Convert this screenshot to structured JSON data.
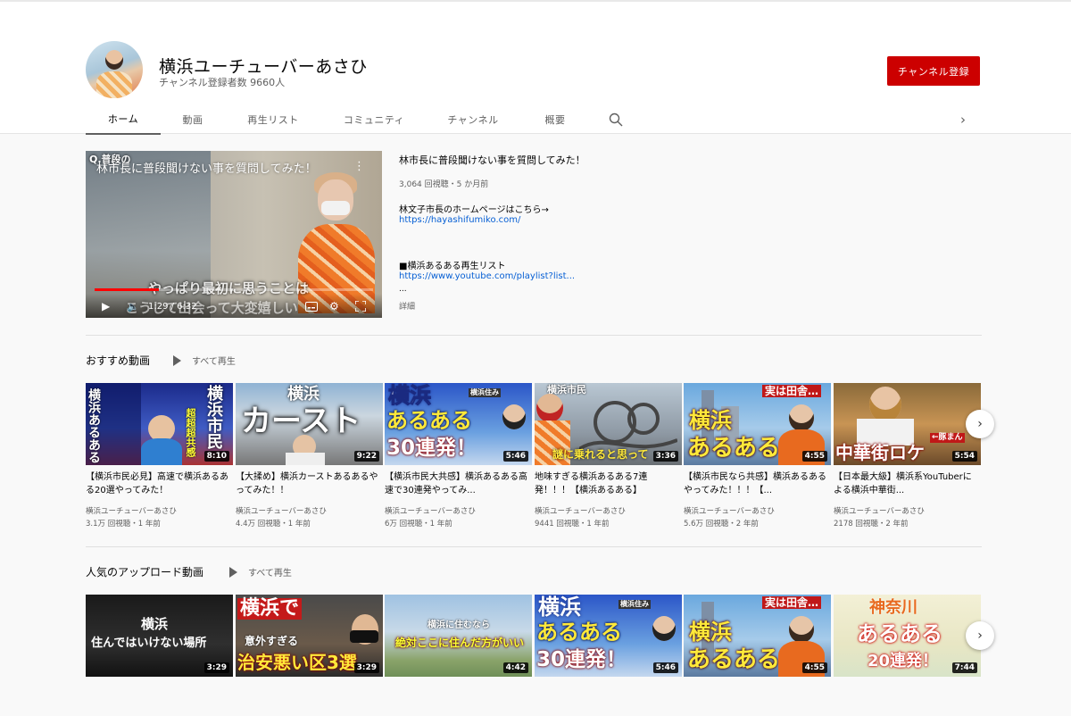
{
  "channel": {
    "name": "横浜ユーチューバーあさひ",
    "subscribers": "チャンネル登録者数 9660人",
    "subscribe_label": "チャンネル登録"
  },
  "tabs": [
    "ホーム",
    "動画",
    "再生リスト",
    "コミュニティ",
    "チャンネル",
    "概要"
  ],
  "featured": {
    "overlay_title": "林市長に普段聞けない事を質問してみた！",
    "overlay_question": "Q.普段の",
    "caption_line1": "やっぱり最初に思うことは",
    "caption_line2": "こうして出会って大変嬉しい",
    "time": "1:29 / 6:32",
    "progress": 0.23,
    "title": "林市長に普段聞けない事を質問してみた！",
    "meta": "3,064 回視聴・5 か月前",
    "desc1": "林文子市長のホームページはこちら→",
    "link1": "https://hayashifumiko.com/",
    "desc2": "■横浜あるある再生リスト",
    "link2": "https://www.youtube.com/playlist?list...",
    "ellipsis": "...",
    "more": "詳細"
  },
  "shelf1": {
    "title": "おすすめ動画",
    "play_all": "すべて再生",
    "videos": [
      {
        "title": "【横浜市民必見】高速で横浜あるある20選やってみた！",
        "channel": "横浜ユーチューバーあさひ",
        "meta": "3.1万 回視聴・1 年前",
        "duration": "8:10",
        "thumb_text": "横浜市民",
        "thumb_text2": "横浜あるある",
        "thumb_sub": "超超超共感"
      },
      {
        "title": "【大揉め】横浜カーストあるあるやってみた！！",
        "channel": "横浜ユーチューバーあさひ",
        "meta": "4.4万 回視聴・1 年前",
        "duration": "9:22",
        "thumb_text": "横浜",
        "thumb_text2": "カースト"
      },
      {
        "title": "【横浜市民大共感】横浜あるある高速で30連発やってみ...",
        "channel": "横浜ユーチューバーあさひ",
        "meta": "6万 回視聴・1 年前",
        "duration": "5:46",
        "thumb_text": "横浜",
        "thumb_text2": "あるある",
        "thumb_sub": "30連発！",
        "thumb_tag": "横浜住み"
      },
      {
        "title": "地味すぎる横浜あるある7連発！！！【横浜あるある】",
        "channel": "横浜ユーチューバーあさひ",
        "meta": "9441 回視聴・1 年前",
        "duration": "3:36",
        "thumb_text": "横浜市民",
        "thumb_text2": "謎に乗れると思って"
      },
      {
        "title": "【横浜市民なら共感】横浜あるあるやってみた！！！【...",
        "channel": "横浜ユーチューバーあさひ",
        "meta": "5.6万 回視聴・2 年前",
        "duration": "4:55",
        "thumb_text": "実は田舎…",
        "thumb_text2": "横浜",
        "thumb_sub": "あるある"
      },
      {
        "title": "【日本最大級】横浜系YouTuberによる横浜中華街...",
        "channel": "横浜ユーチューバーあさひ",
        "meta": "2178 回視聴・2 年前",
        "duration": "5:54",
        "thumb_text": "中華街ロケ",
        "thumb_tag": "←豚まん"
      }
    ]
  },
  "shelf2": {
    "title": "人気のアップロード動画",
    "play_all": "すべて再生",
    "videos": [
      {
        "duration": "3:29",
        "thumb_text": "横浜",
        "thumb_text2": "住んではいけない場所"
      },
      {
        "duration": "3:29",
        "thumb_text": "横浜で",
        "thumb_text2": "意外すぎる",
        "thumb_sub": "治安悪い区3選"
      },
      {
        "duration": "4:42",
        "thumb_text": "横浜に住むなら",
        "thumb_text2": "絶対ここに住んだ方がいい"
      },
      {
        "duration": "5:46",
        "thumb_text": "横浜",
        "thumb_text2": "あるある",
        "thumb_sub": "30連発！",
        "thumb_tag": "横浜住み"
      },
      {
        "duration": "4:55",
        "thumb_text": "実は田舎…",
        "thumb_text2": "横浜",
        "thumb_sub": "あるある"
      },
      {
        "duration": "7:44",
        "thumb_text": "神奈川",
        "thumb_text2": "あるある",
        "thumb_sub": "20連発！"
      }
    ]
  },
  "icons": [
    "search-icon",
    "chevron-right-icon",
    "play-icon",
    "volume-icon",
    "subtitles-icon",
    "gear-icon",
    "fullscreen-icon",
    "more-vert-icon"
  ]
}
